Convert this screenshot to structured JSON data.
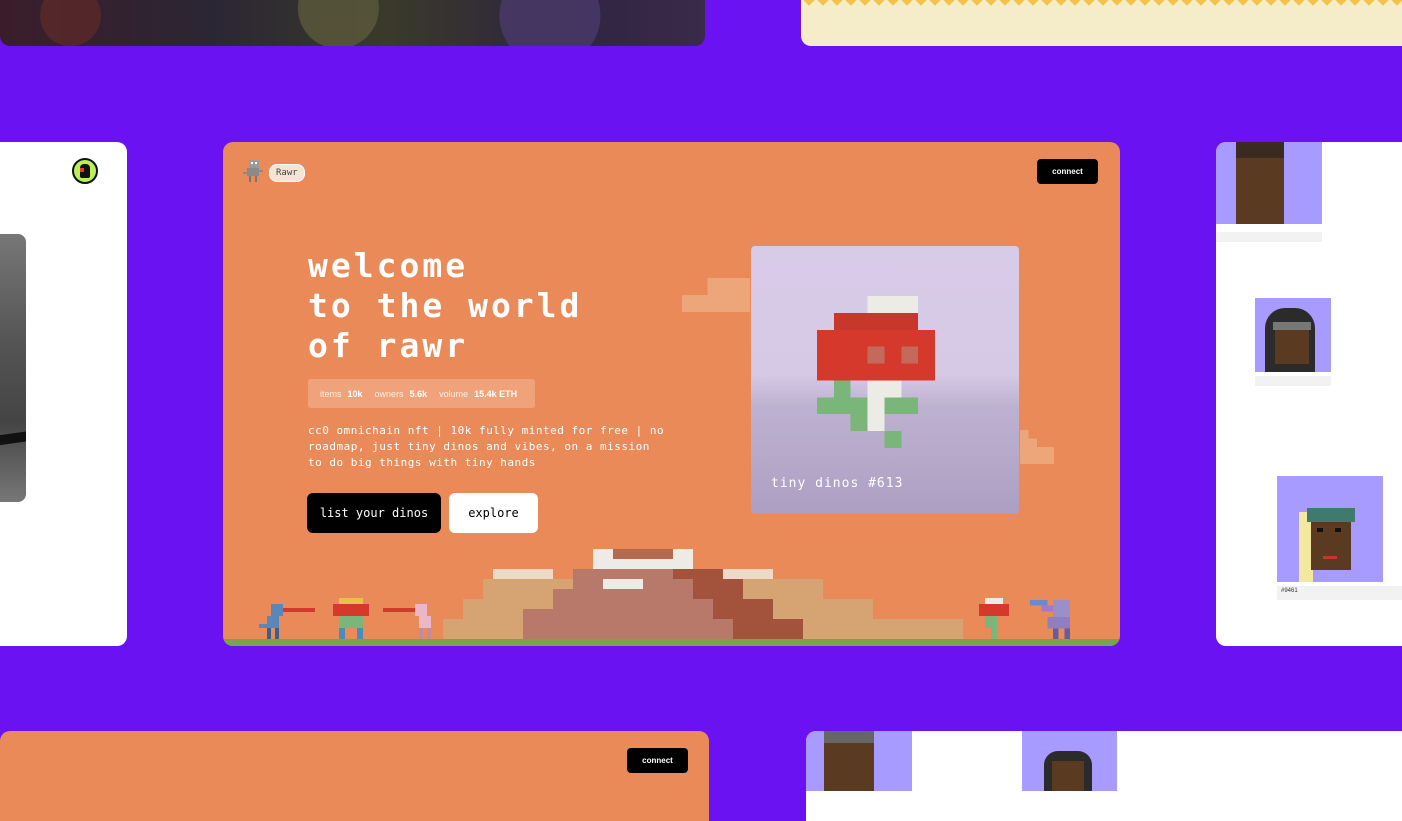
{
  "brand": {
    "name": "Rawr"
  },
  "header": {
    "connect_label": "connect"
  },
  "hero": {
    "title_lines": [
      "welcome",
      "to the world",
      "of rawr"
    ],
    "stats": [
      {
        "key": "items",
        "value": "10k"
      },
      {
        "key": "owners",
        "value": "5.6k"
      },
      {
        "key": "volume",
        "value": "15.4k ETH"
      }
    ],
    "description": "cc0 omnichain nft | 10k fully minted for free | no roadmap, just tiny dinos and vibes, on a mission to do big things with tiny hands",
    "primary_button": "list your dinos",
    "secondary_button": "explore"
  },
  "featured_nft": {
    "caption": "tiny dinos #613"
  },
  "right_panel": {
    "last_thumb_label": "#9461"
  },
  "bottom_window": {
    "connect_label": "connect"
  },
  "colors": {
    "page_bg": "#6a12f2",
    "main_bg": "#ea8a59",
    "button_dark": "#000000",
    "ground": "#79a34d",
    "nft_card_bg": "#d8cbe8",
    "thumb_bg": "#a79bff"
  }
}
